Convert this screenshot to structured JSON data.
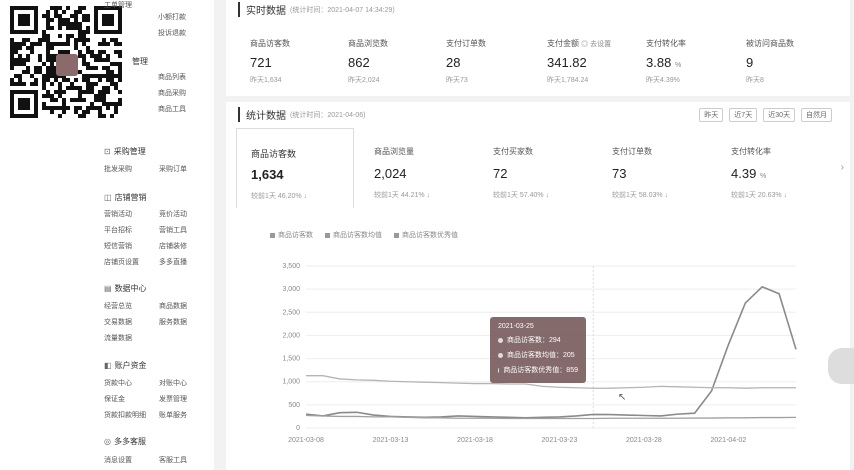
{
  "sidebar": {
    "top_items": [
      "工单管理",
      "小额打款",
      "投诉退款"
    ],
    "mgmt_head": "管理",
    "mgmt_items": [
      "商品列表",
      "商品采购",
      "商品工具"
    ],
    "groups": [
      {
        "title": "采购管理",
        "icon": "cart-icon",
        "items": [
          "批发采购",
          "采购订单"
        ]
      },
      {
        "title": "店铺营销",
        "icon": "megaphone-icon",
        "items": [
          "营销活动",
          "竞价活动",
          "平台招标",
          "营销工具",
          "短信营销",
          "店铺装修",
          "店铺页设置",
          "多多直播"
        ]
      },
      {
        "title": "数据中心",
        "icon": "chart-icon",
        "items": [
          "经营总览",
          "商品数据",
          "交易数据",
          "服务数据",
          "流量数据"
        ]
      },
      {
        "title": "账户资金",
        "icon": "wallet-icon",
        "items": [
          "货款中心",
          "对账中心",
          "保证金",
          "发票管理",
          "货款扣款明细",
          "账单服务"
        ]
      },
      {
        "title": "多多客服",
        "icon": "headset-icon",
        "items": [
          "消息设置",
          "客服工具"
        ]
      }
    ]
  },
  "realtime": {
    "title": "实时数据",
    "updated": "(统计时间：2021-04-07 14:34:29)",
    "metrics": [
      {
        "label": "商品访客数",
        "value": "721",
        "prev": "昨天1,634"
      },
      {
        "label": "商品浏览数",
        "value": "862",
        "prev": "昨天2,024"
      },
      {
        "label": "支付订单数",
        "value": "28",
        "prev": "昨天73"
      },
      {
        "label": "支付金额",
        "suffix": "◎ 去设置",
        "value": "341.82",
        "prev": "昨天1,784.24"
      },
      {
        "label": "支付转化率",
        "value": "3.88",
        "unit": "%",
        "prev": "昨天4.39%"
      },
      {
        "label": "被访问商品数",
        "value": "9",
        "prev": "昨天8"
      }
    ]
  },
  "stats": {
    "title": "统计数据",
    "updated": "(统计时间：2021-04-06)",
    "ranges": [
      "昨天",
      "近7天",
      "近30天",
      "自然月"
    ],
    "cards": [
      {
        "label": "商品访客数",
        "value": "1,634",
        "cmp": "较前1天  46.20% ↓"
      },
      {
        "label": "商品浏览量",
        "value": "2,024",
        "cmp": "较前1天  44.21% ↓"
      },
      {
        "label": "支付买家数",
        "value": "72",
        "cmp": "较前1天  57.40% ↓"
      },
      {
        "label": "支付订单数",
        "value": "73",
        "cmp": "较前1天  58.03% ↓"
      },
      {
        "label": "支付转化率",
        "value": "4.39",
        "unit": "%",
        "cmp": "较前1天  20.63% ↓"
      }
    ],
    "legend": [
      "商品访客数",
      "商品访客数均值",
      "商品访客数优秀值"
    ],
    "tooltip": {
      "date": "2021-03-25",
      "rows": [
        "商品访客数：294",
        "商品访客数均值：205",
        "商品访客数优秀值：859"
      ]
    }
  },
  "chart_data": {
    "type": "line",
    "x": [
      "2021-03-08",
      "2021-03-09",
      "2021-03-10",
      "2021-03-11",
      "2021-03-12",
      "2021-03-13",
      "2021-03-14",
      "2021-03-15",
      "2021-03-16",
      "2021-03-17",
      "2021-03-18",
      "2021-03-19",
      "2021-03-20",
      "2021-03-21",
      "2021-03-22",
      "2021-03-23",
      "2021-03-24",
      "2021-03-25",
      "2021-03-26",
      "2021-03-27",
      "2021-03-28",
      "2021-03-29",
      "2021-03-30",
      "2021-03-31",
      "2021-04-01",
      "2021-04-02",
      "2021-04-03",
      "2021-04-04",
      "2021-04-05",
      "2021-04-06"
    ],
    "x_ticks": [
      "2021-03-08",
      "2021-03-13",
      "2021-03-18",
      "2021-03-23",
      "2021-03-28",
      "2021-04-02"
    ],
    "y_ticks": [
      "0",
      "500",
      "1,000",
      "1,500",
      "2,000",
      "2,500",
      "3,000",
      "3,500"
    ],
    "ylim": [
      0,
      3500
    ],
    "series": [
      {
        "name": "商品访客数",
        "color": "#8a8a8a",
        "values": [
          300,
          260,
          330,
          340,
          280,
          250,
          240,
          230,
          240,
          260,
          250,
          240,
          230,
          220,
          230,
          240,
          260,
          294,
          290,
          280,
          270,
          260,
          300,
          320,
          800,
          1800,
          2700,
          3050,
          2900,
          1700
        ]
      },
      {
        "name": "商品访客数均值",
        "color": "#a0a0a0",
        "values": [
          270,
          260,
          250,
          250,
          240,
          240,
          230,
          220,
          220,
          210,
          210,
          210,
          205,
          205,
          205,
          205,
          205,
          205,
          210,
          210,
          210,
          210,
          210,
          215,
          215,
          220,
          220,
          225,
          225,
          230
        ]
      },
      {
        "name": "商品访客数优秀值",
        "color": "#b4b4b4",
        "values": [
          1130,
          1130,
          1060,
          1040,
          1030,
          1010,
          1000,
          990,
          980,
          970,
          960,
          960,
          950,
          950,
          900,
          880,
          870,
          859,
          860,
          870,
          880,
          900,
          890,
          880,
          870,
          870,
          860,
          870,
          870,
          870
        ]
      }
    ]
  },
  "colors": {
    "accent": "#333333",
    "panel": "#ffffff",
    "page": "#f2f2f2"
  }
}
